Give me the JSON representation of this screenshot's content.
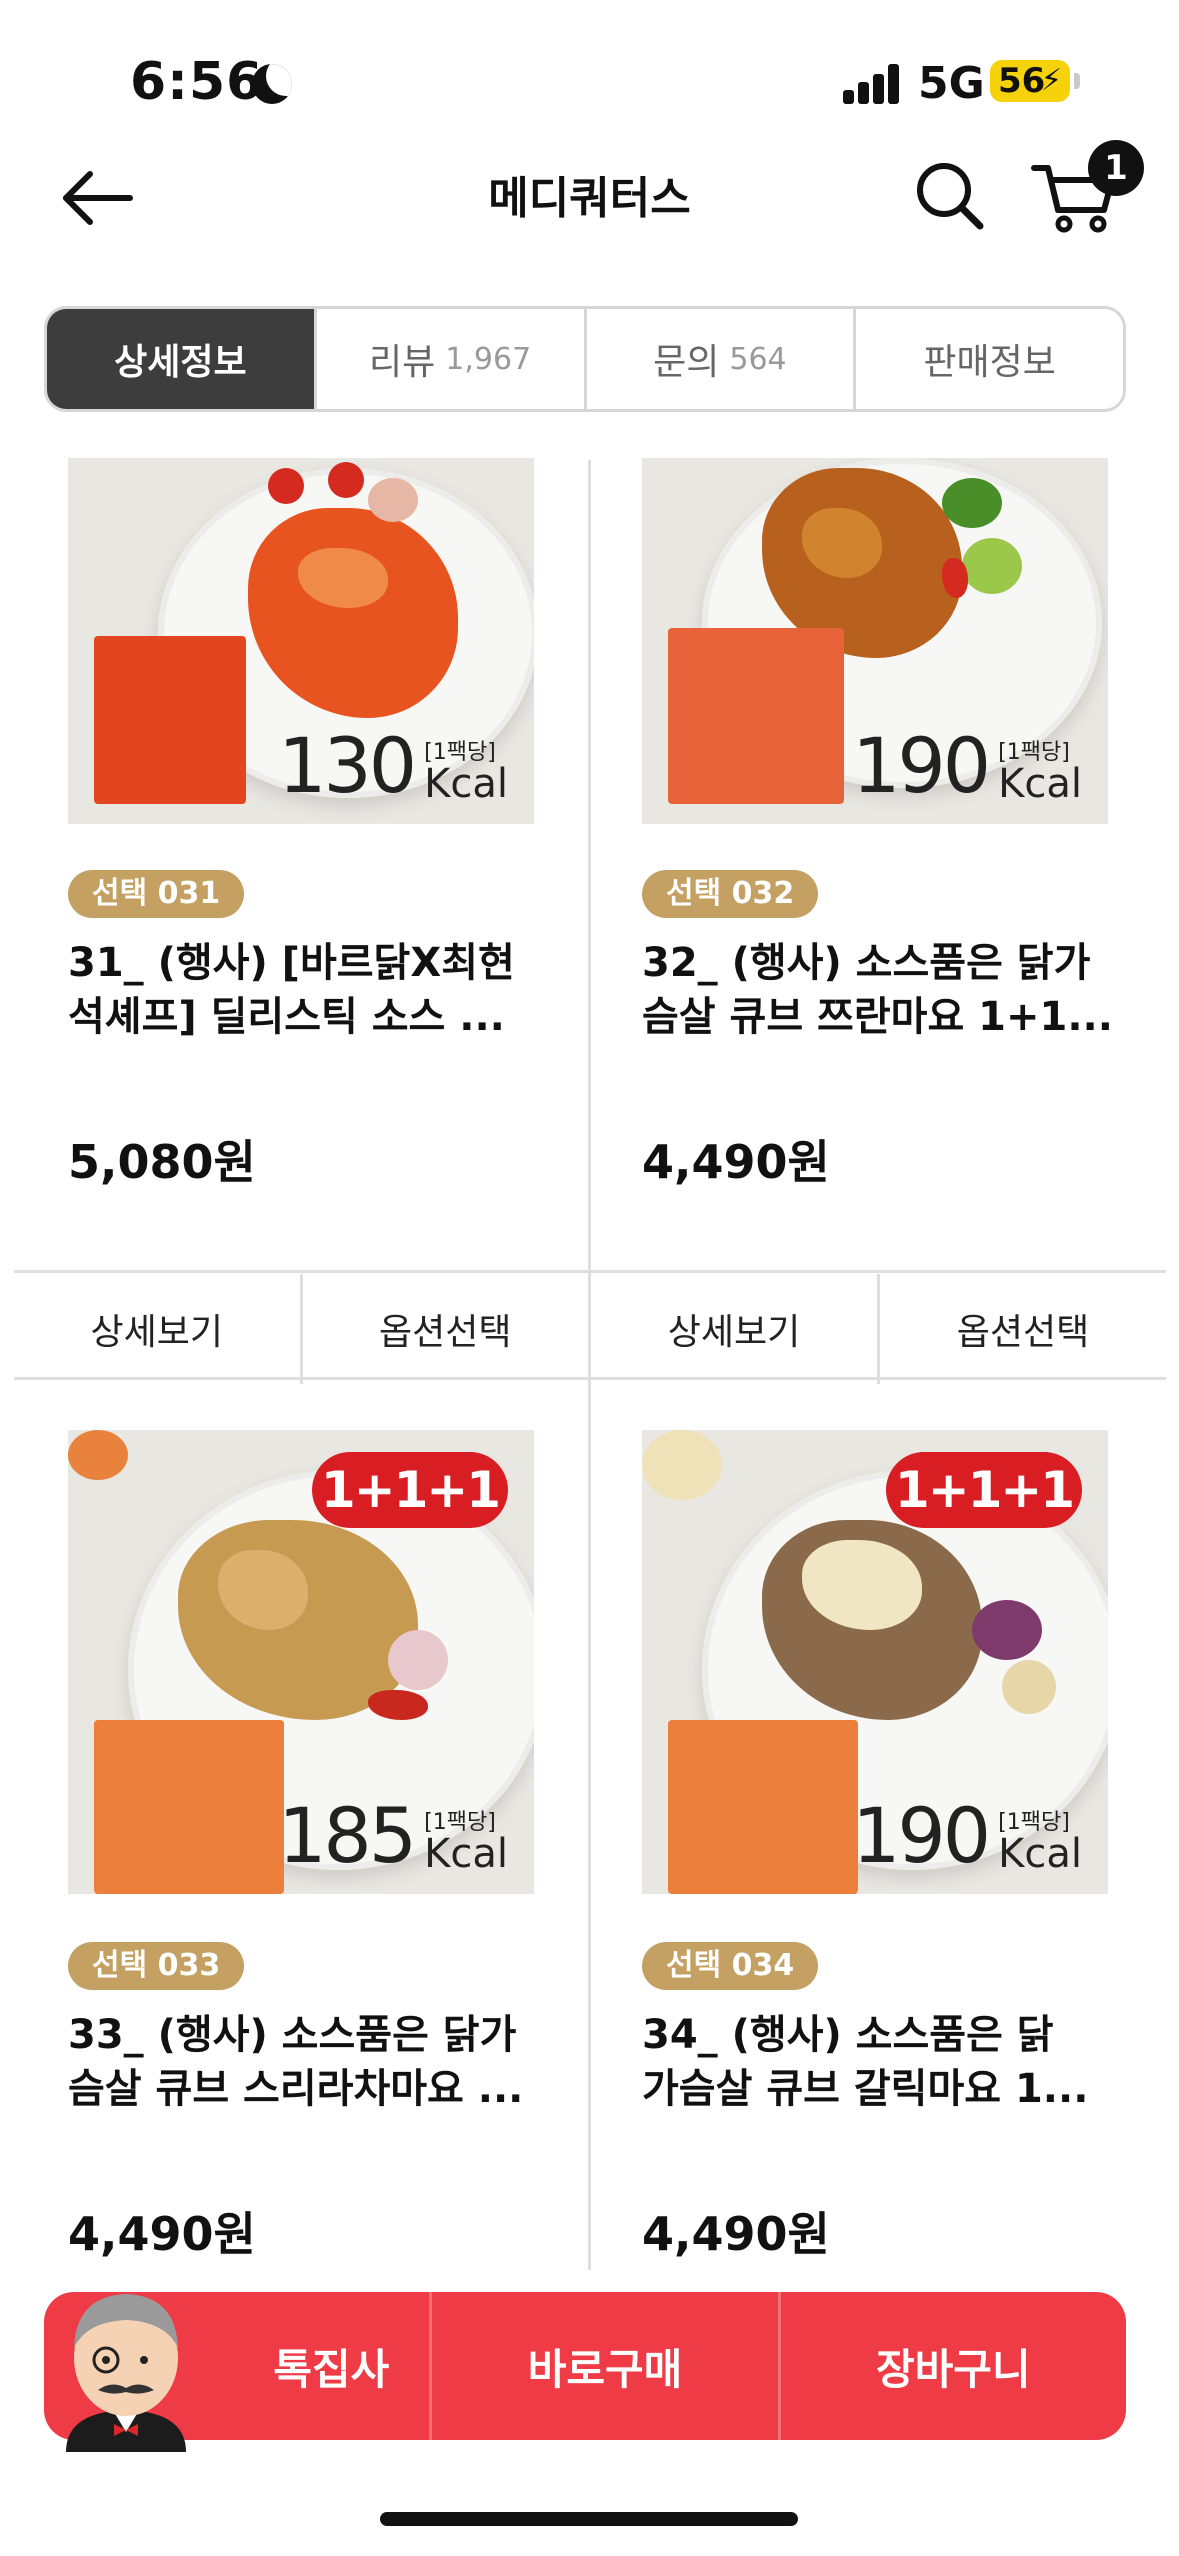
{
  "status_bar": {
    "time": "6:56",
    "network": "5G",
    "battery": "56"
  },
  "header": {
    "title": "메디쿼터스",
    "cart_count": "1"
  },
  "tabs": [
    {
      "label": "상세정보",
      "count": ""
    },
    {
      "label": "리뷰",
      "count": "1,967"
    },
    {
      "label": "문의",
      "count": "564"
    },
    {
      "label": "판매정보",
      "count": ""
    }
  ],
  "products": [
    {
      "badge": "선택 031",
      "name_line1": "31_ (행사) [바르닭X최현",
      "name_line2": "석셰프] 딜리스틱 소스 ...",
      "price": "5,080원",
      "kcal": "130",
      "per_pack": "[1팩당]",
      "kcal_unit": "Kcal",
      "promo": "",
      "detail_label": "상세보기",
      "option_label": "옵션선택"
    },
    {
      "badge": "선택 032",
      "name_line1": "32_ (행사) 소스품은 닭가",
      "name_line2": "슴살 큐브 쯔란마요 1+1...",
      "price": "4,490원",
      "kcal": "190",
      "per_pack": "[1팩당]",
      "kcal_unit": "Kcal",
      "promo": "",
      "detail_label": "상세보기",
      "option_label": "옵션선택"
    },
    {
      "badge": "선택 033",
      "name_line1": "33_ (행사) 소스품은 닭가",
      "name_line2": "슴살 큐브 스리라차마요 ...",
      "price": "4,490원",
      "kcal": "185",
      "per_pack": "[1팩당]",
      "kcal_unit": "Kcal",
      "promo": "1+1+1",
      "detail_label": "",
      "option_label": ""
    },
    {
      "badge": "선택 034",
      "name_line1": "34_ (행사) 소스품은 닭",
      "name_line2": "가슴살 큐브 갈릭마요 1...",
      "price": "4,490원",
      "kcal": "190",
      "per_pack": "[1팩당]",
      "kcal_unit": "Kcal",
      "promo": "1+1+1",
      "detail_label": "",
      "option_label": ""
    }
  ],
  "bottom_bar": {
    "btn1": "톡집사",
    "btn2": "바로구매",
    "btn3": "장바구니"
  },
  "colors": {
    "accent": "#ee3b45",
    "badge": "#c5a063",
    "tab_active": "#3d3d3d",
    "promo": "#d81e23"
  }
}
